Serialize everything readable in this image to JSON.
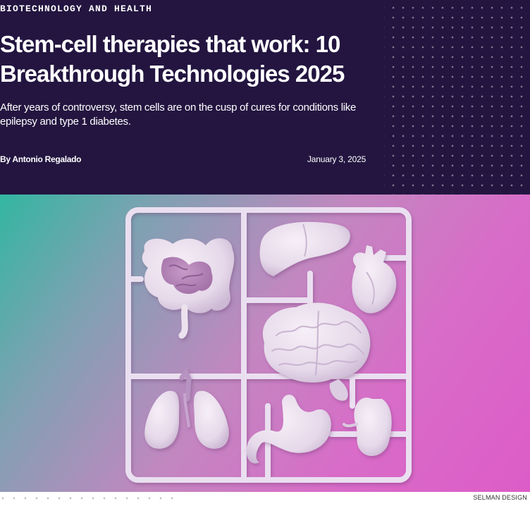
{
  "article": {
    "category": "BIOTECHNOLOGY AND HEALTH",
    "headline": "Stem-cell therapies that work: 10 Breakthrough Technologies 2025",
    "dek": "After years of controversy, stem cells are on the cusp of cures for conditions like epilepsy and type 1 diabetes.",
    "byline_prefix": "By ",
    "author": "Antonio Regalado",
    "date": "January 3, 2025"
  },
  "hero_image": {
    "subject": "organ model-kit sprue: intestines, liver, heart, brain, lungs, stomach, kidney",
    "credit": "SELMAN DESIGN"
  },
  "colors": {
    "header_bg": "#231540",
    "gradient_teal": "#33b6a2",
    "gradient_magenta": "#dd5cc7",
    "organ_fill": "#ece2ee"
  }
}
